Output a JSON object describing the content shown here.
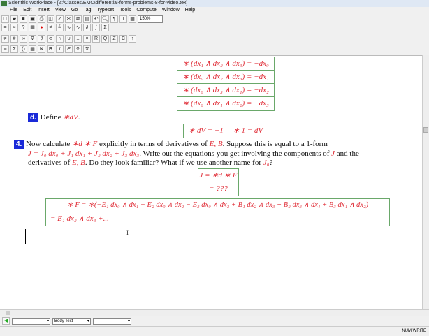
{
  "window": {
    "title": "Scientific WorkPlace - [Z:\\Classes\\EMC\\differential-forms-problems-8-for-video.tex]"
  },
  "menu": [
    "File",
    "Edit",
    "Insert",
    "View",
    "Go",
    "Tag",
    "Typeset",
    "Tools",
    "Compute",
    "Window",
    "Help"
  ],
  "toolbar": {
    "zoom": "150%"
  },
  "doc": {
    "hodge_table": [
      "∗ (dx₁ ∧ dx₂ ∧ dx₃) = −dx₀",
      "∗ (dx₀ ∧ dx₂ ∧ dx₃) = −dx₁",
      "∗ (dx₀ ∧ dx₃ ∧ dx₁) = −dx₂",
      "∗ (dx₀ ∧ dx₁ ∧ dx₂) = −dx₃"
    ],
    "d_tag": "d.",
    "d_text": "Define ",
    "d_math": "∗dV",
    "dv_box": "∗ dV = −1     ∗ 1 = dV",
    "p4_tag": "4.",
    "p4_l1a": "Now calculate ",
    "p4_l1m": "∗d ∗ F",
    "p4_l1b": " explicitly in terms of derivatives of ",
    "p4_l1m2": "E, B",
    "p4_l1c": ". Suppose this is equal to a 1-form",
    "p4_l2m": "J = J₀ dx₀ + J₁ dx₁ + J₂ dx₂ + J₃ dx₃",
    "p4_l2b": ". Write out the equations you get involving the components of ",
    "p4_l2m2": "J",
    "p4_l2c": " and the",
    "p4_l3a": "derivatives of ",
    "p4_l3m": "E, B",
    "p4_l3b": ". Do they look familiar? What if we use another name for ",
    "p4_l3m2": "J₀",
    "p4_l3c": "?",
    "j_table": [
      "J = ∗d ∗ F",
      "= ???"
    ],
    "f_table": [
      "∗ F = ∗(−E₁ dx₀ ∧ dx₁ − E₂ dx₀ ∧ dx₂ − E₃ dx₀ ∧ dx₃ + B₁ dx₂ ∧ dx₃ + B₂ dx₃ ∧ dx₁ + B₃ dx₁ ∧ dx₂)",
      "= E₁ dx₂ ∧ dx₃ +..."
    ]
  },
  "bottom": {
    "style": "Body Text"
  },
  "status": {
    "num": "NUM",
    "write": "WRITE"
  }
}
